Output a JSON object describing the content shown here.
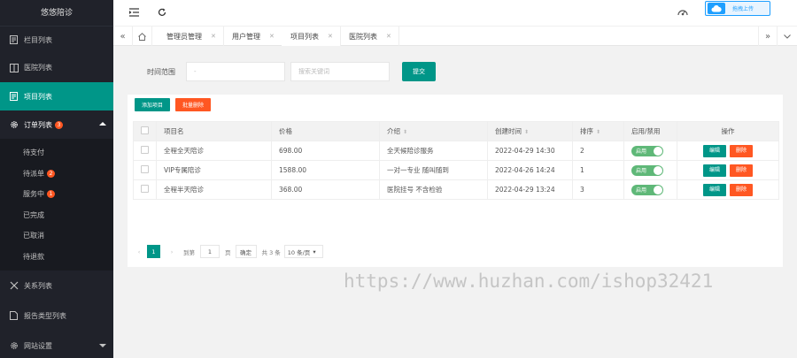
{
  "app": {
    "title": "悠悠陪诊"
  },
  "sidebar": {
    "items": [
      {
        "label": "栏目列表",
        "icon": "document-icon"
      },
      {
        "label": "医院列表",
        "icon": "book-icon"
      },
      {
        "label": "项目列表",
        "icon": "document-icon",
        "active": true
      },
      {
        "label": "订单列表",
        "icon": "gear-icon",
        "badge": "3",
        "open": true
      },
      {
        "label": "关系列表",
        "icon": "link-icon"
      },
      {
        "label": "报告类型列表",
        "icon": "document-icon"
      },
      {
        "label": "网站设置",
        "icon": "gear-icon"
      }
    ],
    "order_sub": [
      {
        "label": "待支付"
      },
      {
        "label": "待派单",
        "badge": "2"
      },
      {
        "label": "服务中",
        "badge": "1"
      },
      {
        "label": "已完成"
      },
      {
        "label": "已取消"
      },
      {
        "label": "待退款"
      }
    ]
  },
  "topbar": {
    "upload_label": "拖拽上传"
  },
  "tabs": [
    {
      "label": "管理员管理"
    },
    {
      "label": "用户管理"
    },
    {
      "label": "项目列表",
      "active": true
    },
    {
      "label": "医院列表"
    }
  ],
  "search": {
    "time_label": "时间范围",
    "time_placeholder": "-",
    "keyword_placeholder": "搜索关键词",
    "submit_label": "提交"
  },
  "toolbar": {
    "add_label": "添加项目",
    "batch_delete_label": "批量删除"
  },
  "table": {
    "headers": [
      "项目名",
      "价格",
      "介绍",
      "创建时间",
      "排序",
      "启用/禁用",
      "操作"
    ],
    "rows": [
      {
        "name": "全程全天陪诊",
        "price": "698.00",
        "intro": "全天候陪诊服务",
        "created": "2022-04-29 14:30",
        "sort": "2",
        "status": "启用"
      },
      {
        "name": "VIP专属陪诊",
        "price": "1588.00",
        "intro": "一对一专业 随叫随到",
        "created": "2022-04-26 14:24",
        "sort": "1",
        "status": "启用"
      },
      {
        "name": "全程半天陪诊",
        "price": "368.00",
        "intro": "医院挂号 不含检验",
        "created": "2022-04-29 13:24",
        "sort": "3",
        "status": "启用"
      }
    ],
    "edit_label": "编辑",
    "delete_label": "删除"
  },
  "pager": {
    "current": "1",
    "goto_label": "到第",
    "goto_value": "1",
    "page_unit": "页",
    "confirm_label": "确定",
    "total_label": "共 3 条",
    "per_page": "10 条/页"
  },
  "watermark": "https://www.huzhan.com/ishop32421",
  "colors": {
    "primary": "#009688",
    "danger": "#ff5722",
    "sidebar": "#20222a",
    "accent": "#1e9fff",
    "switch_on": "#5fb878"
  }
}
